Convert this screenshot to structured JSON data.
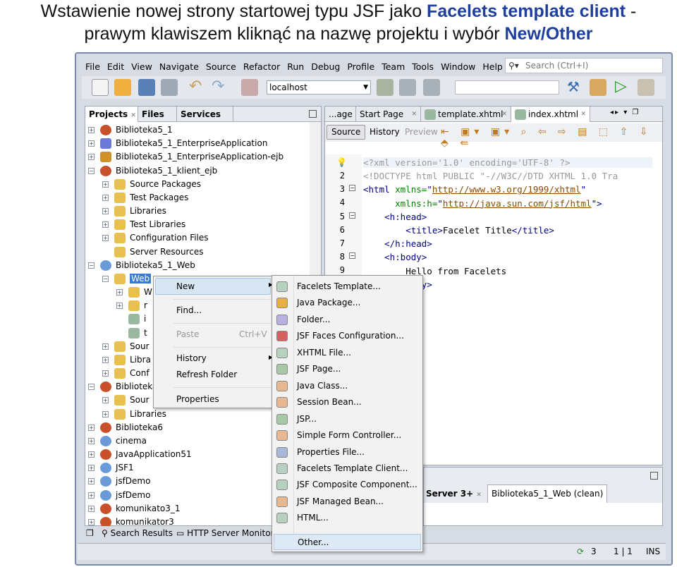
{
  "caption": {
    "line1_plain": "Wstawienie nowej strony startowej typu JSF jako ",
    "line1_bold": "Facelets template client",
    "line1_tail": " -",
    "line2_plain": "prawym klawiszem kliknąć na nazwę projektu i wybór ",
    "line2_bold": "New/Other"
  },
  "menu": [
    "File",
    "Edit",
    "View",
    "Navigate",
    "Source",
    "Refactor",
    "Run",
    "Debug",
    "Profile",
    "Team",
    "Tools",
    "Window",
    "Help"
  ],
  "search": {
    "placeholder": "Search (Ctrl+I)"
  },
  "toolbar": {
    "server": "localhost"
  },
  "projects_panel": {
    "tabs": [
      "Projects",
      "Files",
      "Services"
    ],
    "tree": [
      {
        "l": 0,
        "t": "Biblioteka5_1",
        "e": "+",
        "i": "coffee-cup-icon",
        "c": "#c8502a"
      },
      {
        "l": 0,
        "t": "Biblioteka5_1_EnterpriseApplication",
        "e": "+",
        "i": "triangle-icon",
        "c": "#6a7ad8"
      },
      {
        "l": 0,
        "t": "Biblioteka5_1_EnterpriseApplication-ejb",
        "e": "+",
        "i": "bean-icon",
        "c": "#d0902a"
      },
      {
        "l": 0,
        "t": "Biblioteka5_1_klient_ejb",
        "e": "-",
        "i": "coffee-cup-icon",
        "c": "#c8502a"
      },
      {
        "l": 1,
        "t": "Source Packages",
        "e": "+",
        "i": "folder-icon",
        "c": "#e8c050"
      },
      {
        "l": 1,
        "t": "Test Packages",
        "e": "+",
        "i": "folder-icon",
        "c": "#e8c050"
      },
      {
        "l": 1,
        "t": "Libraries",
        "e": "+",
        "i": "folder-icon",
        "c": "#e8c050"
      },
      {
        "l": 1,
        "t": "Test Libraries",
        "e": "+",
        "i": "folder-icon",
        "c": "#e8c050"
      },
      {
        "l": 1,
        "t": "Configuration Files",
        "e": "+",
        "i": "folder-icon",
        "c": "#e8c050"
      },
      {
        "l": 1,
        "t": "Server Resources",
        "e": "",
        "i": "folder-icon",
        "c": "#e8c050"
      },
      {
        "l": 0,
        "t": "Biblioteka5_1_Web",
        "e": "-",
        "i": "globe-icon",
        "c": "#6a9ad8"
      },
      {
        "l": 1,
        "t": "Web",
        "e": "-",
        "i": "folder-icon",
        "c": "#e8c050",
        "sel": true
      },
      {
        "l": 2,
        "t": "W",
        "e": "+",
        "i": "folder-icon",
        "c": "#e8c050"
      },
      {
        "l": 2,
        "t": "r",
        "e": "+",
        "i": "folder-icon",
        "c": "#e8c050"
      },
      {
        "l": 2,
        "t": "i",
        "e": "",
        "i": "xhtml-file-icon",
        "c": "#9ab8a0"
      },
      {
        "l": 2,
        "t": "t",
        "e": "",
        "i": "xhtml-file-icon",
        "c": "#9ab8a0"
      },
      {
        "l": 1,
        "t": "Sour",
        "e": "+",
        "i": "folder-icon",
        "c": "#e8c050"
      },
      {
        "l": 1,
        "t": "Libra",
        "e": "+",
        "i": "folder-icon",
        "c": "#e8c050"
      },
      {
        "l": 1,
        "t": "Conf",
        "e": "+",
        "i": "folder-icon",
        "c": "#e8c050"
      },
      {
        "l": 0,
        "t": "Biblioteka",
        "e": "-",
        "i": "coffee-cup-icon",
        "c": "#c8502a"
      },
      {
        "l": 1,
        "t": "Sour",
        "e": "+",
        "i": "folder-icon",
        "c": "#e8c050"
      },
      {
        "l": 1,
        "t": "Libraries",
        "e": "+",
        "i": "folder-icon",
        "c": "#e8c050"
      },
      {
        "l": 0,
        "t": "Biblioteka6",
        "e": "+",
        "i": "coffee-cup-icon",
        "c": "#c8502a"
      },
      {
        "l": 0,
        "t": "cinema",
        "e": "+",
        "i": "globe-icon",
        "c": "#6a9ad8"
      },
      {
        "l": 0,
        "t": "JavaApplication51",
        "e": "+",
        "i": "coffee-cup-icon",
        "c": "#c8502a"
      },
      {
        "l": 0,
        "t": "JSF1",
        "e": "+",
        "i": "globe-icon",
        "c": "#6a9ad8"
      },
      {
        "l": 0,
        "t": "jsfDemo",
        "e": "+",
        "i": "globe-icon",
        "c": "#6a9ad8"
      },
      {
        "l": 0,
        "t": "jsfDemo",
        "e": "+",
        "i": "globe-icon",
        "c": "#6a9ad8"
      },
      {
        "l": 0,
        "t": "komunikato3_1",
        "e": "+",
        "i": "coffee-cup-icon",
        "c": "#c8502a"
      },
      {
        "l": 0,
        "t": "komunikator3",
        "e": "+",
        "i": "coffee-cup-icon",
        "c": "#c8502a"
      }
    ]
  },
  "editor": {
    "tabs": [
      "...age",
      "Start Page",
      "template.xhtml",
      "index.xhtml"
    ],
    "views": [
      "Source",
      "History",
      "Preview"
    ],
    "line_numbers": [
      "2",
      "3",
      "4",
      "5",
      "6",
      "7",
      "8",
      "9"
    ],
    "lines": [
      [
        [
          "p",
          "<?xml version='1.0' encoding='UTF-8' ?>"
        ]
      ],
      [
        [
          "p",
          "<!DOCTYPE html PUBLIC \"-//W3C//DTD XHTML 1.0 Tra"
        ]
      ],
      [
        [
          "t",
          "<html "
        ],
        [
          "a",
          "xmlns="
        ],
        [
          "t",
          "\""
        ],
        [
          "s",
          "http://www.w3.org/1999/xhtml"
        ],
        [
          "t",
          "\""
        ]
      ],
      [
        [
          "t",
          "      "
        ],
        [
          "a",
          "xmlns:h="
        ],
        [
          "t",
          "\""
        ],
        [
          "s",
          "http://java.sun.com/jsf/html"
        ],
        [
          "t",
          "\">"
        ]
      ],
      [
        [
          "t",
          "    <h:head>"
        ]
      ],
      [
        [
          "t",
          "        <title>"
        ],
        [
          "b",
          "Facelet Title"
        ],
        [
          "t",
          "</title>"
        ]
      ],
      [
        [
          "t",
          "    </h:head>"
        ]
      ],
      [
        [
          "t",
          "    <h:body>"
        ]
      ],
      [
        [
          "b",
          "        Hello from Facelets"
        ]
      ],
      [
        [
          "t",
          "    </h:body>"
        ]
      ]
    ]
  },
  "context_menu": {
    "new": "New",
    "find": "Find...",
    "paste": "Paste",
    "paste_shortcut": "Ctrl+V",
    "history": "History",
    "refresh": "Refresh Folder",
    "properties": "Properties"
  },
  "submenu": [
    {
      "t": "Facelets Template...",
      "i": "xhtml-file-icon"
    },
    {
      "t": "Java Package...",
      "i": "package-icon"
    },
    {
      "t": "Folder...",
      "i": "folder-icon"
    },
    {
      "t": "JSF Faces Configuration...",
      "i": "jsf-config-icon"
    },
    {
      "t": "XHTML File...",
      "i": "xhtml-file-icon"
    },
    {
      "t": "JSF Page...",
      "i": "jsf-page-icon"
    },
    {
      "t": "Java Class...",
      "i": "java-class-icon"
    },
    {
      "t": "Session Bean...",
      "i": "bean-icon"
    },
    {
      "t": "JSP...",
      "i": "jsp-icon"
    },
    {
      "t": "Simple Form Controller...",
      "i": "java-class-icon"
    },
    {
      "t": "Properties File...",
      "i": "properties-file-icon"
    },
    {
      "t": "Facelets Template Client...",
      "i": "xhtml-file-icon"
    },
    {
      "t": "JSF Composite Component...",
      "i": "xhtml-file-icon"
    },
    {
      "t": "JSF Managed Bean...",
      "i": "bean-icon"
    },
    {
      "t": "HTML...",
      "i": "xhtml-file-icon"
    },
    {
      "t": "Other...",
      "i": ""
    }
  ],
  "output": {
    "tabs": [
      "Server 3+",
      "Biblioteka5_1_Web (clean)"
    ]
  },
  "bottom_bar": {
    "search_results": "Search Results",
    "http_monitor": "HTTP Server Monitor"
  },
  "status": {
    "notifications": "3",
    "position": "1 | 1",
    "mode": "INS"
  }
}
